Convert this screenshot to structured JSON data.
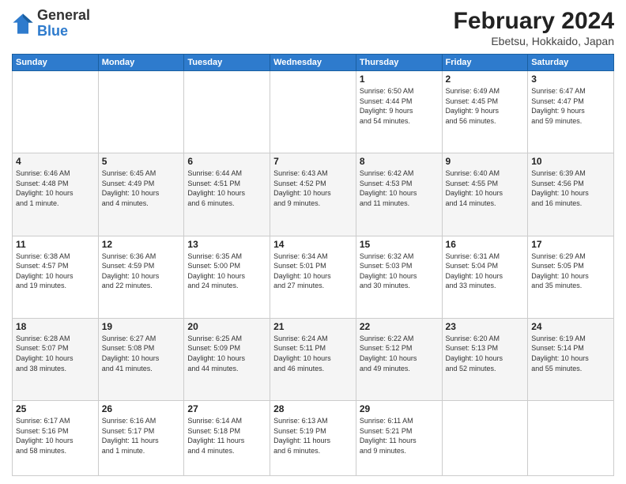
{
  "logo": {
    "general": "General",
    "blue": "Blue"
  },
  "title": "February 2024",
  "subtitle": "Ebetsu, Hokkaido, Japan",
  "days": [
    "Sunday",
    "Monday",
    "Tuesday",
    "Wednesday",
    "Thursday",
    "Friday",
    "Saturday"
  ],
  "weeks": [
    [
      {
        "num": "",
        "info": ""
      },
      {
        "num": "",
        "info": ""
      },
      {
        "num": "",
        "info": ""
      },
      {
        "num": "",
        "info": ""
      },
      {
        "num": "1",
        "info": "Sunrise: 6:50 AM\nSunset: 4:44 PM\nDaylight: 9 hours\nand 54 minutes."
      },
      {
        "num": "2",
        "info": "Sunrise: 6:49 AM\nSunset: 4:45 PM\nDaylight: 9 hours\nand 56 minutes."
      },
      {
        "num": "3",
        "info": "Sunrise: 6:47 AM\nSunset: 4:47 PM\nDaylight: 9 hours\nand 59 minutes."
      }
    ],
    [
      {
        "num": "4",
        "info": "Sunrise: 6:46 AM\nSunset: 4:48 PM\nDaylight: 10 hours\nand 1 minute."
      },
      {
        "num": "5",
        "info": "Sunrise: 6:45 AM\nSunset: 4:49 PM\nDaylight: 10 hours\nand 4 minutes."
      },
      {
        "num": "6",
        "info": "Sunrise: 6:44 AM\nSunset: 4:51 PM\nDaylight: 10 hours\nand 6 minutes."
      },
      {
        "num": "7",
        "info": "Sunrise: 6:43 AM\nSunset: 4:52 PM\nDaylight: 10 hours\nand 9 minutes."
      },
      {
        "num": "8",
        "info": "Sunrise: 6:42 AM\nSunset: 4:53 PM\nDaylight: 10 hours\nand 11 minutes."
      },
      {
        "num": "9",
        "info": "Sunrise: 6:40 AM\nSunset: 4:55 PM\nDaylight: 10 hours\nand 14 minutes."
      },
      {
        "num": "10",
        "info": "Sunrise: 6:39 AM\nSunset: 4:56 PM\nDaylight: 10 hours\nand 16 minutes."
      }
    ],
    [
      {
        "num": "11",
        "info": "Sunrise: 6:38 AM\nSunset: 4:57 PM\nDaylight: 10 hours\nand 19 minutes."
      },
      {
        "num": "12",
        "info": "Sunrise: 6:36 AM\nSunset: 4:59 PM\nDaylight: 10 hours\nand 22 minutes."
      },
      {
        "num": "13",
        "info": "Sunrise: 6:35 AM\nSunset: 5:00 PM\nDaylight: 10 hours\nand 24 minutes."
      },
      {
        "num": "14",
        "info": "Sunrise: 6:34 AM\nSunset: 5:01 PM\nDaylight: 10 hours\nand 27 minutes."
      },
      {
        "num": "15",
        "info": "Sunrise: 6:32 AM\nSunset: 5:03 PM\nDaylight: 10 hours\nand 30 minutes."
      },
      {
        "num": "16",
        "info": "Sunrise: 6:31 AM\nSunset: 5:04 PM\nDaylight: 10 hours\nand 33 minutes."
      },
      {
        "num": "17",
        "info": "Sunrise: 6:29 AM\nSunset: 5:05 PM\nDaylight: 10 hours\nand 35 minutes."
      }
    ],
    [
      {
        "num": "18",
        "info": "Sunrise: 6:28 AM\nSunset: 5:07 PM\nDaylight: 10 hours\nand 38 minutes."
      },
      {
        "num": "19",
        "info": "Sunrise: 6:27 AM\nSunset: 5:08 PM\nDaylight: 10 hours\nand 41 minutes."
      },
      {
        "num": "20",
        "info": "Sunrise: 6:25 AM\nSunset: 5:09 PM\nDaylight: 10 hours\nand 44 minutes."
      },
      {
        "num": "21",
        "info": "Sunrise: 6:24 AM\nSunset: 5:11 PM\nDaylight: 10 hours\nand 46 minutes."
      },
      {
        "num": "22",
        "info": "Sunrise: 6:22 AM\nSunset: 5:12 PM\nDaylight: 10 hours\nand 49 minutes."
      },
      {
        "num": "23",
        "info": "Sunrise: 6:20 AM\nSunset: 5:13 PM\nDaylight: 10 hours\nand 52 minutes."
      },
      {
        "num": "24",
        "info": "Sunrise: 6:19 AM\nSunset: 5:14 PM\nDaylight: 10 hours\nand 55 minutes."
      }
    ],
    [
      {
        "num": "25",
        "info": "Sunrise: 6:17 AM\nSunset: 5:16 PM\nDaylight: 10 hours\nand 58 minutes."
      },
      {
        "num": "26",
        "info": "Sunrise: 6:16 AM\nSunset: 5:17 PM\nDaylight: 11 hours\nand 1 minute."
      },
      {
        "num": "27",
        "info": "Sunrise: 6:14 AM\nSunset: 5:18 PM\nDaylight: 11 hours\nand 4 minutes."
      },
      {
        "num": "28",
        "info": "Sunrise: 6:13 AM\nSunset: 5:19 PM\nDaylight: 11 hours\nand 6 minutes."
      },
      {
        "num": "29",
        "info": "Sunrise: 6:11 AM\nSunset: 5:21 PM\nDaylight: 11 hours\nand 9 minutes."
      },
      {
        "num": "",
        "info": ""
      },
      {
        "num": "",
        "info": ""
      }
    ]
  ]
}
